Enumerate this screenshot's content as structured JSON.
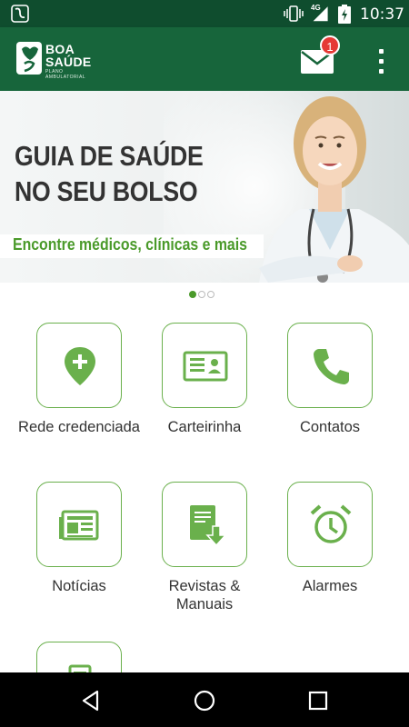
{
  "status_bar": {
    "network_label": "4G",
    "time": "10:37"
  },
  "app_bar": {
    "logo_line1": "BOA",
    "logo_line2": "SAÚDE",
    "logo_line3": "PLANO AMBULATORIAL",
    "notification_count": "1",
    "colors": {
      "bar": "#17653b",
      "status": "#0f4d2e",
      "badge": "#e53935"
    }
  },
  "banner": {
    "headline_line1": "GUIA DE SAÚDE",
    "headline_line2": "NO SEU BOLSO",
    "tagline": "Encontre médicos, clínicas e mais",
    "pages": 3,
    "active_page": 1
  },
  "menu": {
    "accent": "#6ab04c",
    "items": [
      {
        "label": "Rede credenciada",
        "icon": "map-pin-plus-icon"
      },
      {
        "label": "Carteirinha",
        "icon": "id-card-icon"
      },
      {
        "label": "Contatos",
        "icon": "phone-icon"
      },
      {
        "label": "Notícias",
        "icon": "newspaper-icon"
      },
      {
        "label": "Revistas & Manuais",
        "icon": "document-download-icon"
      },
      {
        "label": "Alarmes",
        "icon": "alarm-clock-icon"
      },
      {
        "label": "",
        "icon": "document-icon"
      }
    ]
  }
}
